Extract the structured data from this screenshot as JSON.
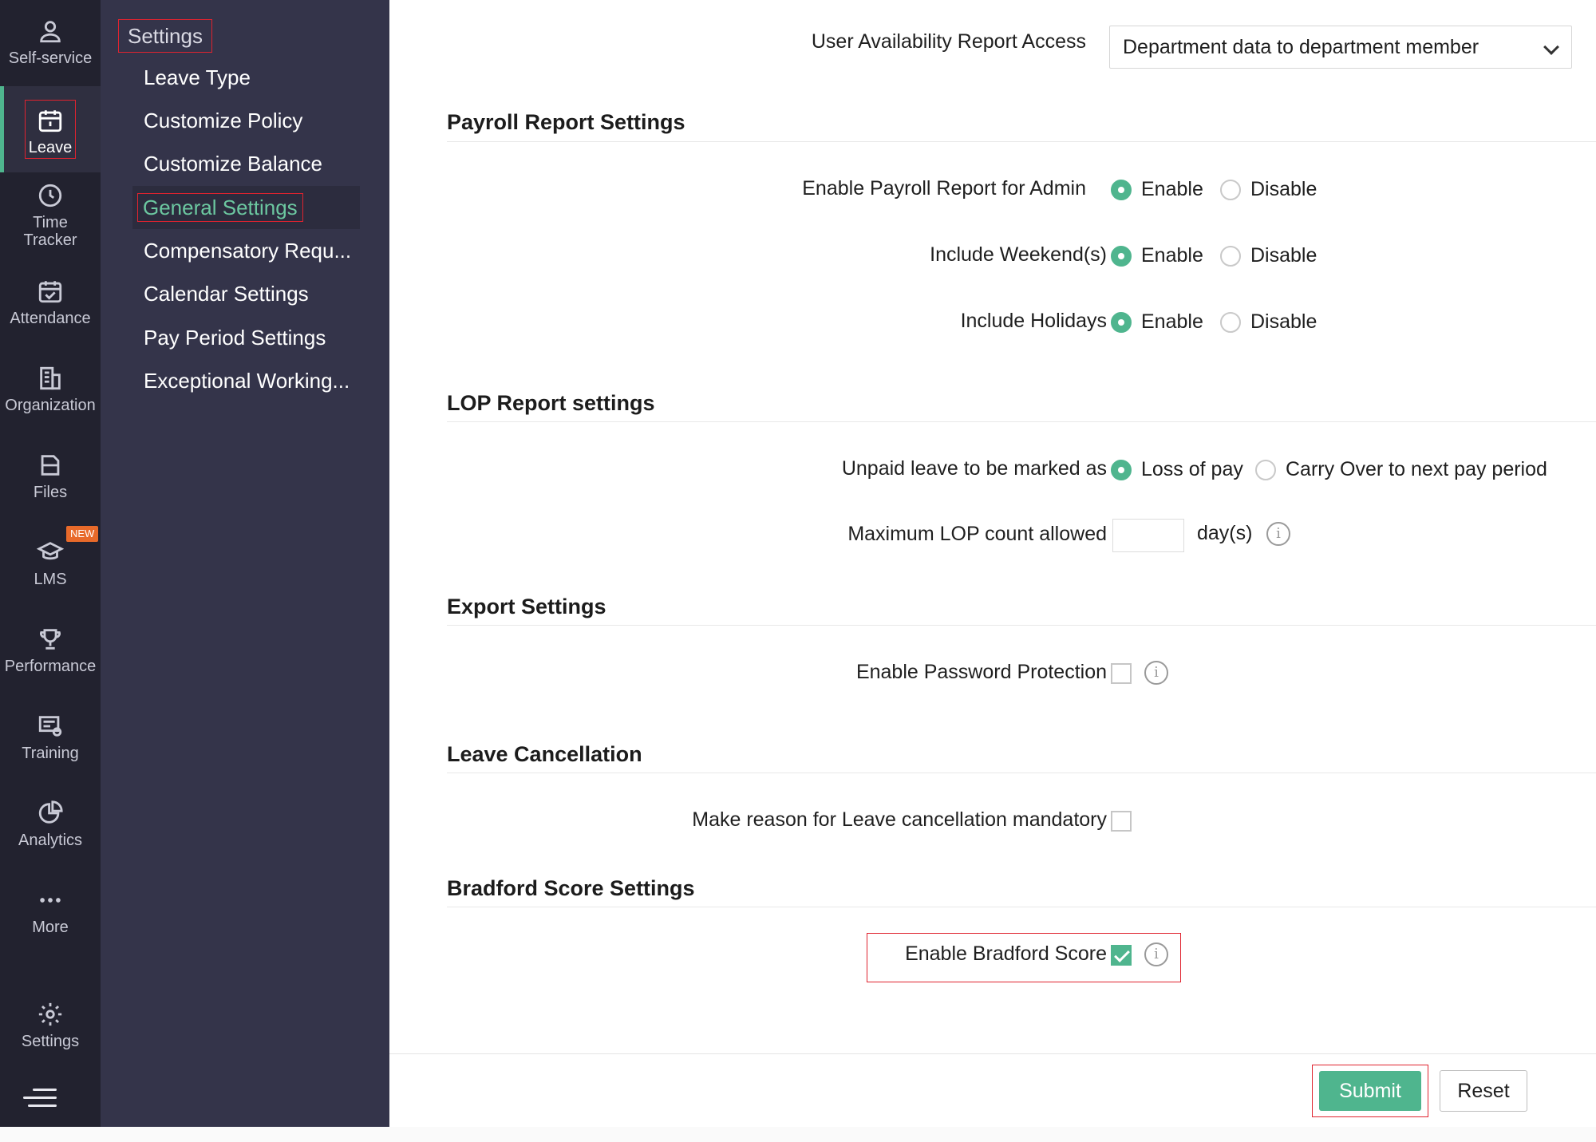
{
  "rail": {
    "items": [
      {
        "label": "Self-service",
        "icon": "user-icon"
      },
      {
        "label": "Leave",
        "icon": "calendar-leave-icon"
      },
      {
        "label": "Time\nTracker",
        "icon": "clock-icon"
      },
      {
        "label": "Attendance",
        "icon": "calendar-check-icon"
      },
      {
        "label": "Organization",
        "icon": "building-icon"
      },
      {
        "label": "Files",
        "icon": "files-icon"
      },
      {
        "label": "LMS",
        "icon": "graduation-cap-icon"
      },
      {
        "label": "Performance",
        "icon": "trophy-icon"
      },
      {
        "label": "Training",
        "icon": "training-icon"
      },
      {
        "label": "Analytics",
        "icon": "pie-chart-icon"
      },
      {
        "label": "More",
        "icon": "more-dots-icon"
      },
      {
        "label": "Settings",
        "icon": "gear-icon"
      }
    ],
    "new_badge": "NEW",
    "accent_color": "#4fb58e"
  },
  "submenu": {
    "title": "Settings",
    "items": [
      {
        "label": "Leave Type"
      },
      {
        "label": "Customize Policy"
      },
      {
        "label": "Customize Balance"
      },
      {
        "label": "General Settings"
      },
      {
        "label": "Compensatory Requ..."
      },
      {
        "label": "Calendar Settings"
      },
      {
        "label": "Pay Period Settings"
      },
      {
        "label": "Exceptional Working..."
      }
    ]
  },
  "availability": {
    "label": "User Availability Report Access",
    "value": "Department data to department member"
  },
  "payroll": {
    "title": "Payroll Report Settings",
    "rows": [
      {
        "label": "Enable Payroll Report for Admin",
        "on": "Enable",
        "off": "Disable"
      },
      {
        "label": "Include Weekend(s)",
        "on": "Enable",
        "off": "Disable"
      },
      {
        "label": "Include Holidays",
        "on": "Enable",
        "off": "Disable"
      }
    ]
  },
  "lop": {
    "title": "LOP Report settings",
    "unpaid_label": "Unpaid leave to be marked as",
    "option_a": "Loss of pay",
    "option_b": "Carry Over to next pay period",
    "max_label": "Maximum LOP count allowed",
    "max_value": "",
    "unit": "day(s)"
  },
  "export": {
    "title": "Export Settings",
    "password_label": "Enable Password Protection"
  },
  "cancellation": {
    "title": "Leave Cancellation",
    "reason_label": "Make reason for Leave cancellation mandatory"
  },
  "bradford": {
    "title": "Bradford Score Settings",
    "enable_label": "Enable Bradford Score"
  },
  "footer": {
    "submit": "Submit",
    "reset": "Reset"
  }
}
